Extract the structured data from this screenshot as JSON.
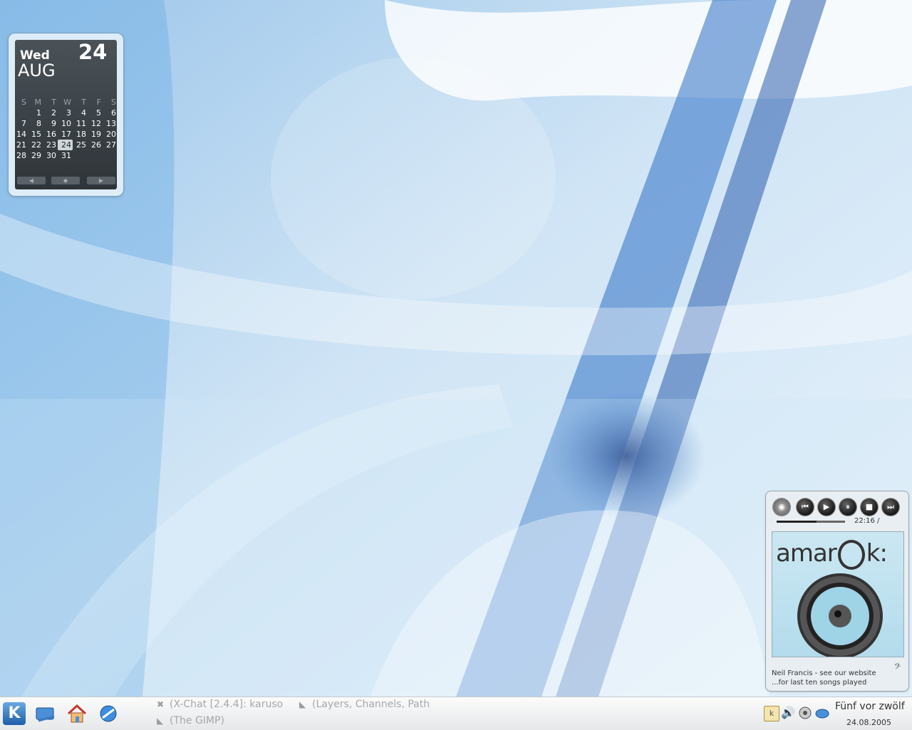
{
  "calendar": {
    "weekday": "Wed",
    "month": "AUG",
    "day": "24",
    "weekday_headers": [
      "S",
      "M",
      "T",
      "W",
      "T",
      "F",
      "S"
    ],
    "weeks": [
      [
        "",
        "1",
        "2",
        "3",
        "4",
        "5",
        "6"
      ],
      [
        "7",
        "8",
        "9",
        "10",
        "11",
        "12",
        "13"
      ],
      [
        "14",
        "15",
        "16",
        "17",
        "18",
        "19",
        "20"
      ],
      [
        "21",
        "22",
        "23",
        "24",
        "25",
        "26",
        "27"
      ],
      [
        "28",
        "29",
        "30",
        "31",
        "",
        "",
        ""
      ]
    ],
    "today": "24"
  },
  "amarok": {
    "time": "22:16 /",
    "logo_text": "amarok",
    "track_line1": "Neil Francis - see our website",
    "track_line2": "...for last ten songs played",
    "progress": 0.58
  },
  "taskbar": {
    "tasks": [
      {
        "label": "(X-Chat [2.4.4]: karuso",
        "icon": "xchat-icon"
      },
      {
        "label": "(Layers, Channels, Path",
        "icon": "gimp-icon"
      },
      {
        "label": "(The GIMP)",
        "icon": "gimp-icon"
      }
    ],
    "clock_text": "Fünf vor zwölf",
    "clock_date": "24.08.2005"
  }
}
